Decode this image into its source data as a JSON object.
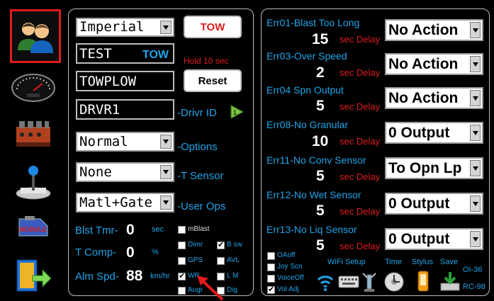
{
  "sidebar": {
    "items": [
      {
        "name": "users",
        "active": true
      },
      {
        "name": "gauge"
      },
      {
        "name": "valves"
      },
      {
        "name": "joystick"
      },
      {
        "name": "module",
        "label": "MODULE"
      },
      {
        "name": "exit"
      }
    ]
  },
  "left": {
    "units": "Imperial",
    "tow_button": "TOW",
    "test_field": "TEST",
    "test_tow": "TOW",
    "hold_text": "Hold 10 sec",
    "towplow_field": "TOWPLOW",
    "reset_button": "Reset",
    "driver_field": "DRVR1",
    "driver_label": "-Drivr ID",
    "options_value": "Normal",
    "options_label": "-Options",
    "tsensor_value": "None",
    "tsensor_label": "-T Sensor",
    "userops_value": "Matl+Gate",
    "userops_label": "-User Ops",
    "blst_tmr_label": "Blst Tmr-",
    "blst_tmr_value": "0",
    "blst_tmr_unit": "sec",
    "tcomp_label": "T Comp-",
    "tcomp_value": "0",
    "tcomp_unit": "%",
    "alm_spd_label": "Alm Spd-",
    "alm_spd_value": "88",
    "alm_spd_unit": "km/hr",
    "checkboxes": [
      {
        "label": "mBlast",
        "checked": false
      },
      {
        "label": "Dimr",
        "checked": false
      },
      {
        "label": "B sw",
        "checked": true
      },
      {
        "label": "GPS",
        "checked": false
      },
      {
        "label": "AVL",
        "checked": false
      },
      {
        "label": "WR",
        "checked": true
      },
      {
        "label": "L M",
        "checked": false
      },
      {
        "label": "Augr",
        "checked": false
      },
      {
        "label": "Dig",
        "checked": false
      }
    ]
  },
  "right": {
    "errors": [
      {
        "title": "Err01-Blast Too Long",
        "delay": "15",
        "delay_unit": "sec Delay",
        "action": "No Action"
      },
      {
        "title": "Err03-Over Speed",
        "delay": "2",
        "delay_unit": "sec Delay",
        "action": "No Action"
      },
      {
        "title": "Err04 Spn Output",
        "delay": "5",
        "delay_unit": "sec Delay",
        "action": "No Action"
      },
      {
        "title": "Err08-No Granular",
        "delay": "10",
        "delay_unit": "sec Delay",
        "action": "0 Output"
      },
      {
        "title": "Err11-No Conv Sensor",
        "delay": "5",
        "delay_unit": "sec Delay",
        "action": "To Opn Lp"
      },
      {
        "title": "Err12-No Wet Sensor",
        "delay": "5",
        "delay_unit": "sec Delay",
        "action": "0 Output"
      },
      {
        "title": "Err13-No Liq Sensor",
        "delay": "5",
        "delay_unit": "sec Delay",
        "action": "0 Output"
      }
    ],
    "bottom_checks": [
      {
        "label": "OAoff",
        "checked": false
      },
      {
        "label": "Joy Scn",
        "checked": false
      },
      {
        "label": "VoiceOff",
        "checked": false
      },
      {
        "label": "Vol Adj",
        "checked": true
      }
    ],
    "wifi_label": "WiFi Setup",
    "time_label": "Time",
    "stylus_label": "Stylus",
    "save_label": "Save",
    "version_1": "OI-36",
    "version_2": "RC-98"
  }
}
